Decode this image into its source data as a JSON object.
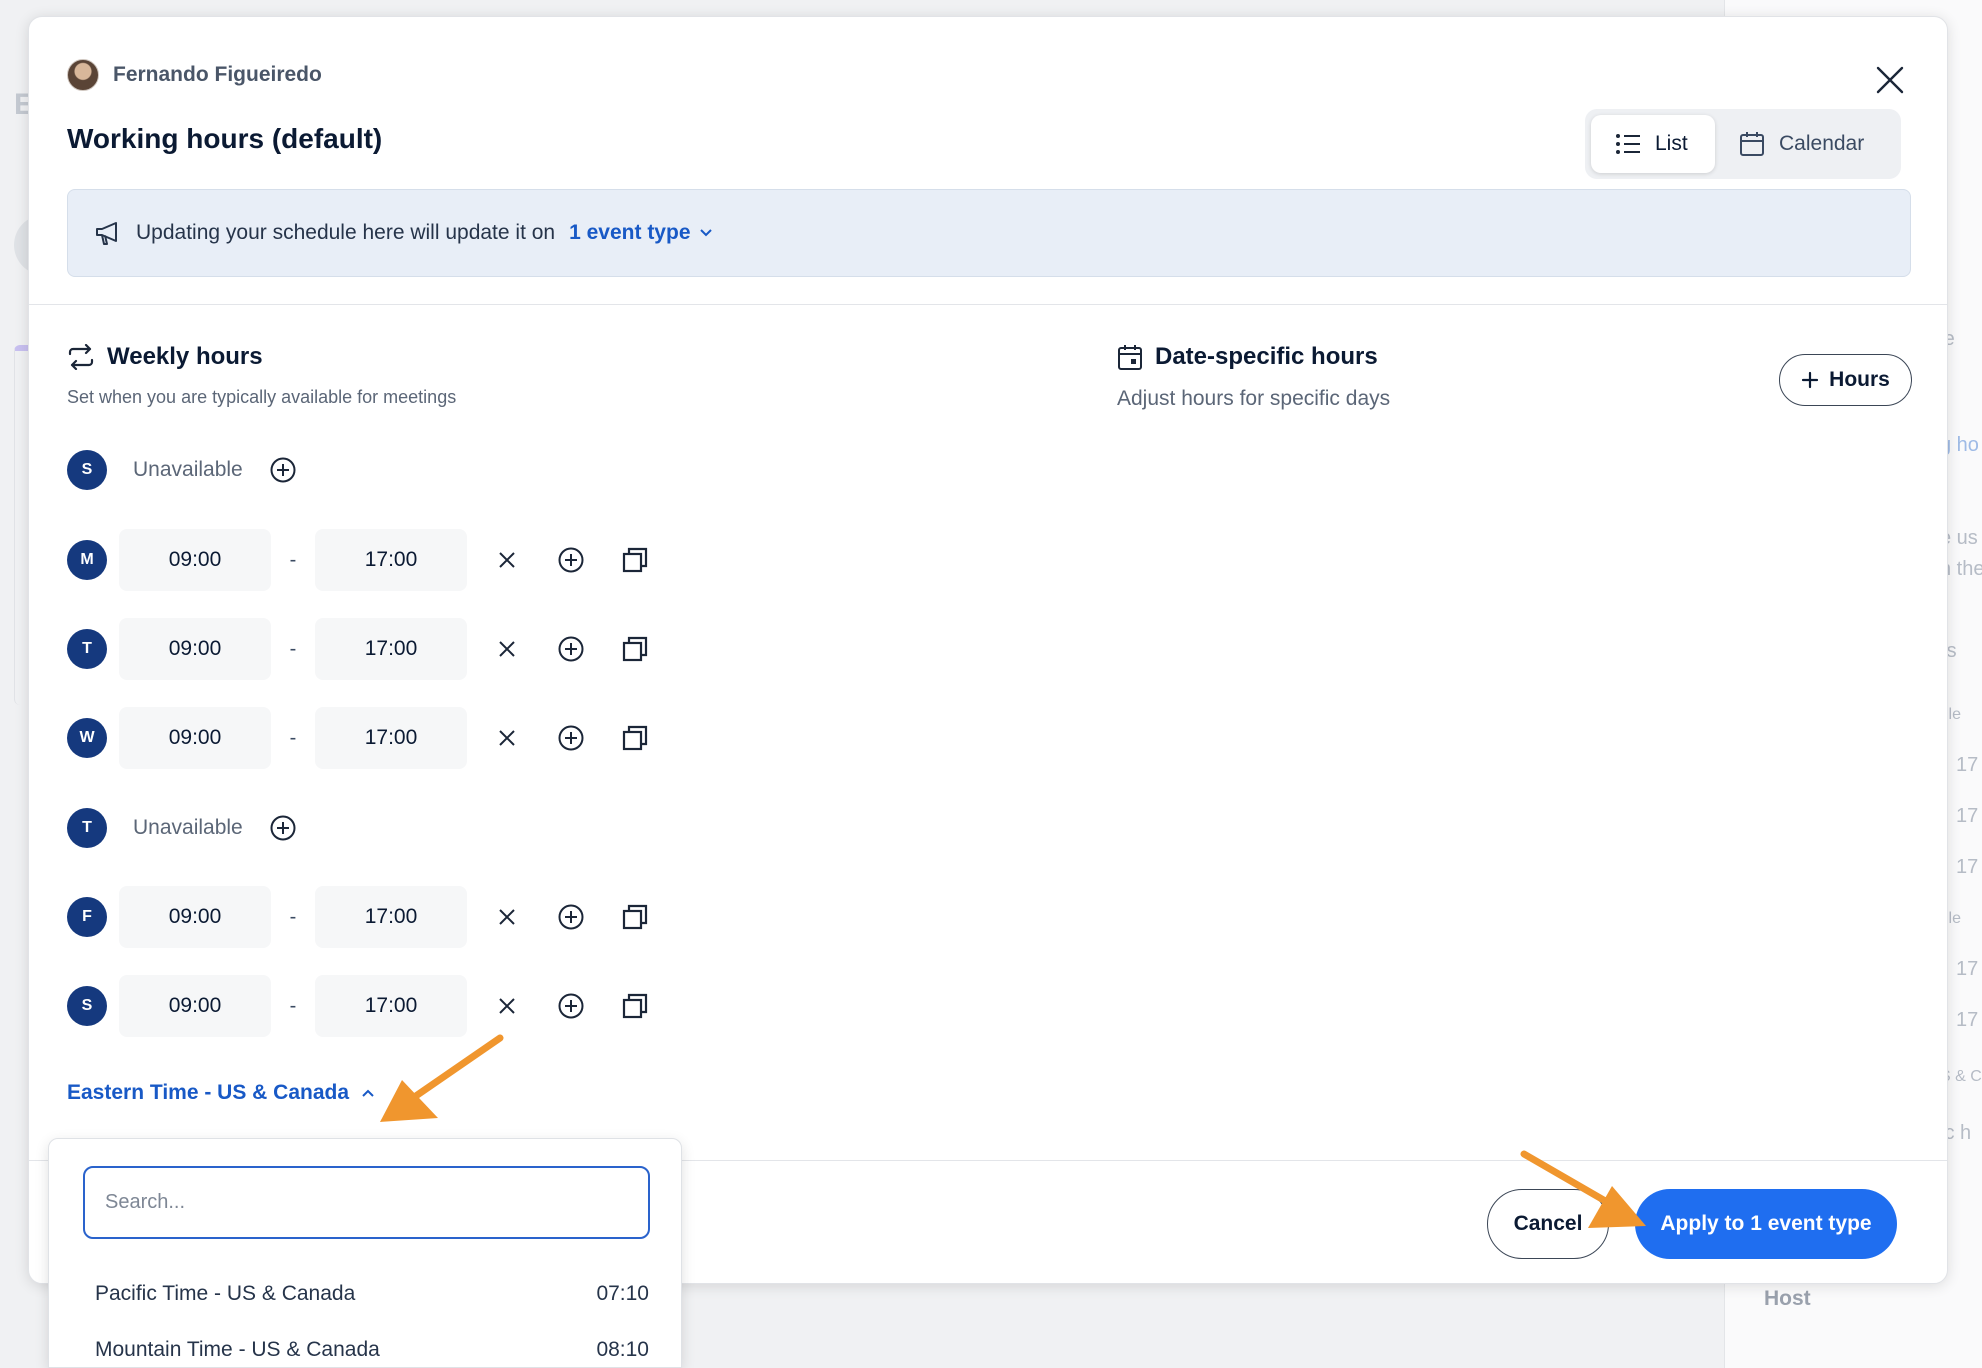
{
  "background": {
    "fragments": [
      "ule",
      "g ho",
      "e us",
      "n the",
      "rs",
      "ile",
      "17",
      "17",
      "17",
      "ile",
      "17",
      "17",
      "S & C",
      "ic h"
    ],
    "host_label": "Host",
    "left_letter": "E"
  },
  "header": {
    "owner_name": "Fernando Figueiredo",
    "title": "Working hours (default)",
    "view_toggle": {
      "list_label": "List",
      "calendar_label": "Calendar",
      "active": "List"
    }
  },
  "notice": {
    "text": "Updating your schedule here will update it on",
    "link_label": "1 event type"
  },
  "weekly": {
    "title": "Weekly hours",
    "subtitle": "Set when you are typically available for meetings",
    "unavailable_label": "Unavailable",
    "days": [
      {
        "letter": "S",
        "available": false
      },
      {
        "letter": "M",
        "available": true,
        "start": "09:00",
        "end": "17:00"
      },
      {
        "letter": "T",
        "available": true,
        "start": "09:00",
        "end": "17:00"
      },
      {
        "letter": "W",
        "available": true,
        "start": "09:00",
        "end": "17:00"
      },
      {
        "letter": "T",
        "available": false
      },
      {
        "letter": "F",
        "available": true,
        "start": "09:00",
        "end": "17:00"
      },
      {
        "letter": "S",
        "available": true,
        "start": "09:00",
        "end": "17:00"
      }
    ],
    "separator": "-"
  },
  "date_specific": {
    "title": "Date-specific hours",
    "subtitle": "Adjust hours for specific days",
    "add_button_label": "Hours"
  },
  "timezone": {
    "current": "Eastern Time - US & Canada",
    "search_placeholder": "Search...",
    "options": [
      {
        "name": "Pacific Time - US & Canada",
        "time": "07:10"
      },
      {
        "name": "Mountain Time - US & Canada",
        "time": "08:10"
      }
    ]
  },
  "footer": {
    "cancel_label": "Cancel",
    "apply_label": "Apply to 1 event type"
  },
  "colors": {
    "primary": "#1f6ef0",
    "link": "#1859c6",
    "day_badge": "#15397e",
    "annotation_arrow": "#f0962e",
    "notice_bg": "#e8eef7"
  }
}
